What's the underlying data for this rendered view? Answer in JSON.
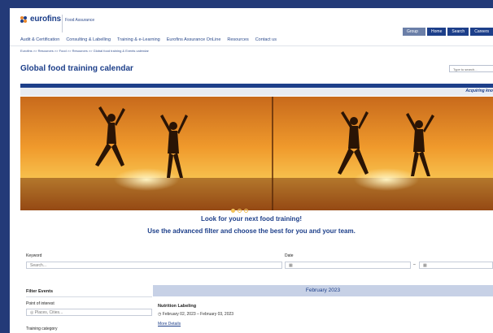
{
  "header": {
    "logo_text": "eurofins",
    "logo_sub": "Food Assurance",
    "top_buttons": [
      "Group Menu ▾",
      "Home",
      "Search",
      "Careers"
    ]
  },
  "nav": {
    "items": [
      "Audit & Certification",
      "Consulting & Labelling",
      "Training & e-Learning",
      "Eurofins Assurance OnLine",
      "Resources",
      "Contact us"
    ]
  },
  "breadcrumb": "Eurofins >> Resources >> Food >> Resources >> Global food training & Events calendar",
  "page_title": "Global food training calendar",
  "search_placeholder": "Type to search...",
  "banner_text": "Acquiring kno",
  "promo": {
    "line1": "Look for your next food training!",
    "line2": "Use the advanced filter and choose the best for you and your team."
  },
  "filters": {
    "keyword_label": "Keyword",
    "keyword_placeholder": "Search...",
    "date_label": "Date",
    "filter_events": "Filter Events",
    "poi_label": "Point of interest",
    "poi_placeholder": "Places, Cities...",
    "category_label": "Training category"
  },
  "calendar": {
    "month": "February 2023",
    "event": {
      "title": "Nutrition Labeling",
      "dates": "February 02, 2023 – February 03, 2023",
      "more": "More Details"
    }
  },
  "colors": {
    "brand": "#1d3f8a",
    "background": "#233a78",
    "month_bar": "#c7d1e6"
  }
}
